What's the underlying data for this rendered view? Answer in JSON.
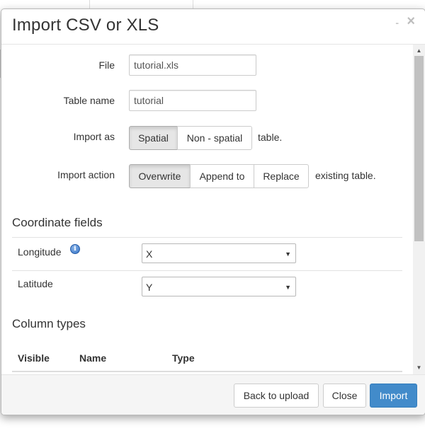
{
  "dialog": {
    "title": "Import CSV or XLS",
    "minimize_glyph": "-",
    "close_glyph": "×"
  },
  "form": {
    "file": {
      "label": "File",
      "value": "tutorial.xls"
    },
    "table_name": {
      "label": "Table name",
      "value": "tutorial"
    },
    "import_as": {
      "label": "Import as",
      "options": [
        "Spatial",
        "Non - spatial"
      ],
      "selected": "Spatial",
      "suffix": "table."
    },
    "import_action": {
      "label": "Import action",
      "options": [
        "Overwrite",
        "Append to",
        "Replace"
      ],
      "selected": "Overwrite",
      "suffix": "existing table."
    }
  },
  "coordinate_fields": {
    "title": "Coordinate fields",
    "longitude": {
      "label": "Longitude",
      "icon": "info-icon",
      "value": "X"
    },
    "latitude": {
      "label": "Latitude",
      "value": "Y"
    }
  },
  "column_types": {
    "title": "Column types",
    "headers": [
      "Visible",
      "Name",
      "Type"
    ]
  },
  "footer": {
    "back": "Back to upload",
    "close": "Close",
    "import": "Import"
  },
  "scrollbar": {
    "up_glyph": "▲",
    "down_glyph": "▼"
  },
  "colors": {
    "primary": "#428bca",
    "active_button": "#e6e6e6",
    "footer_bg": "#f5f5f5"
  }
}
